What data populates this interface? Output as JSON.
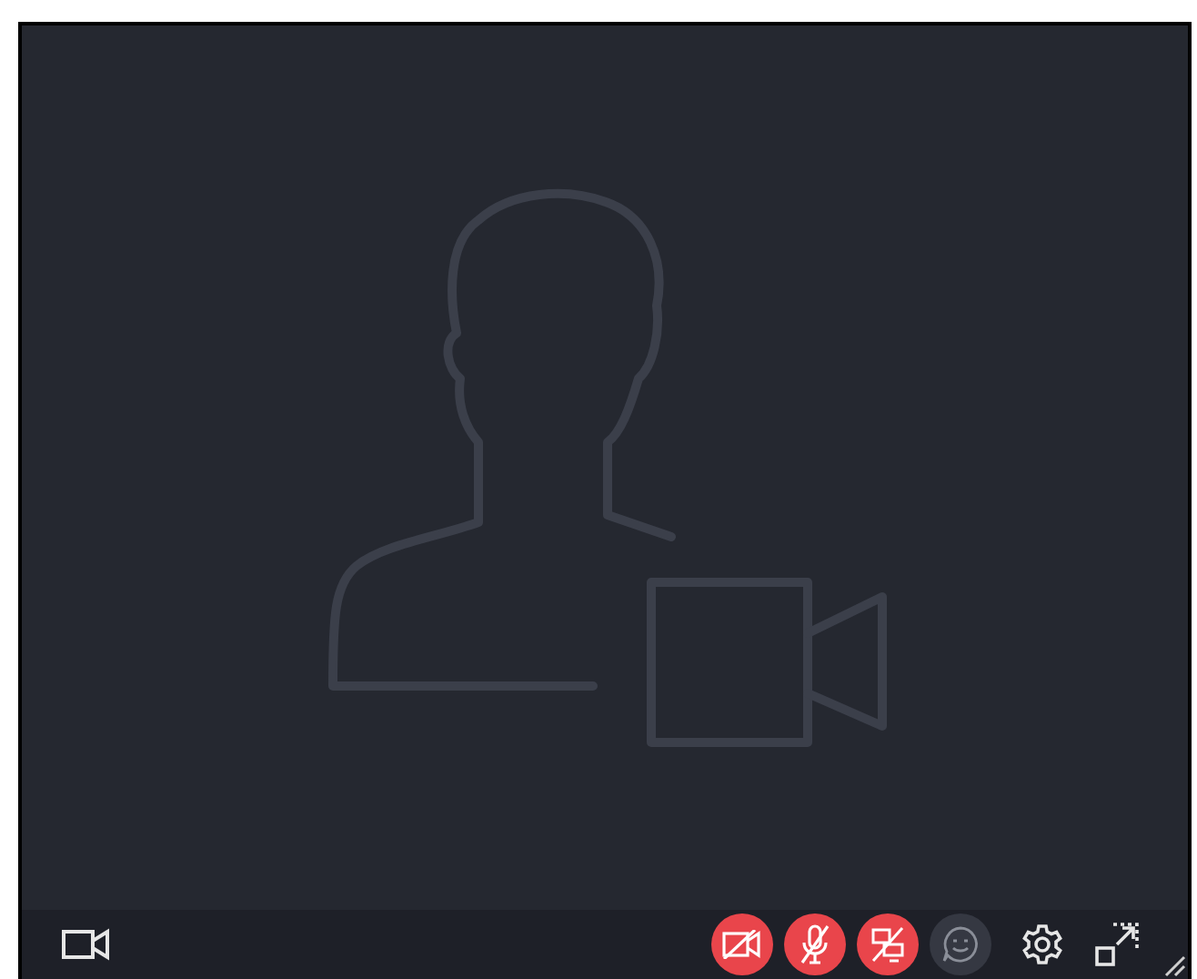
{
  "controls": [
    {
      "kind": "camera",
      "muted": true
    },
    {
      "kind": "microphone",
      "muted": true
    },
    {
      "kind": "screen",
      "muted": true
    },
    {
      "kind": "chat"
    }
  ]
}
